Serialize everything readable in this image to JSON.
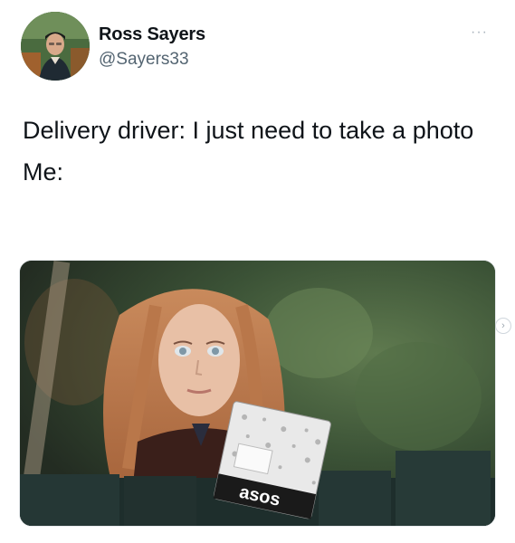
{
  "tweet": {
    "author_name": "Ross Sayers",
    "author_handle": "@Sayers33",
    "more_glyph": "···",
    "text_line1": "Delivery driver: I just need to take a photo",
    "text_line2": "Me:"
  },
  "media": {
    "package_brand": "asos"
  },
  "icons": {
    "more": "more-options-icon",
    "next": "chevron-right-icon"
  },
  "side_arrow_glyph": "›",
  "colors": {
    "text_primary": "#0f1419",
    "text_secondary": "#536471",
    "background": "#ffffff"
  }
}
